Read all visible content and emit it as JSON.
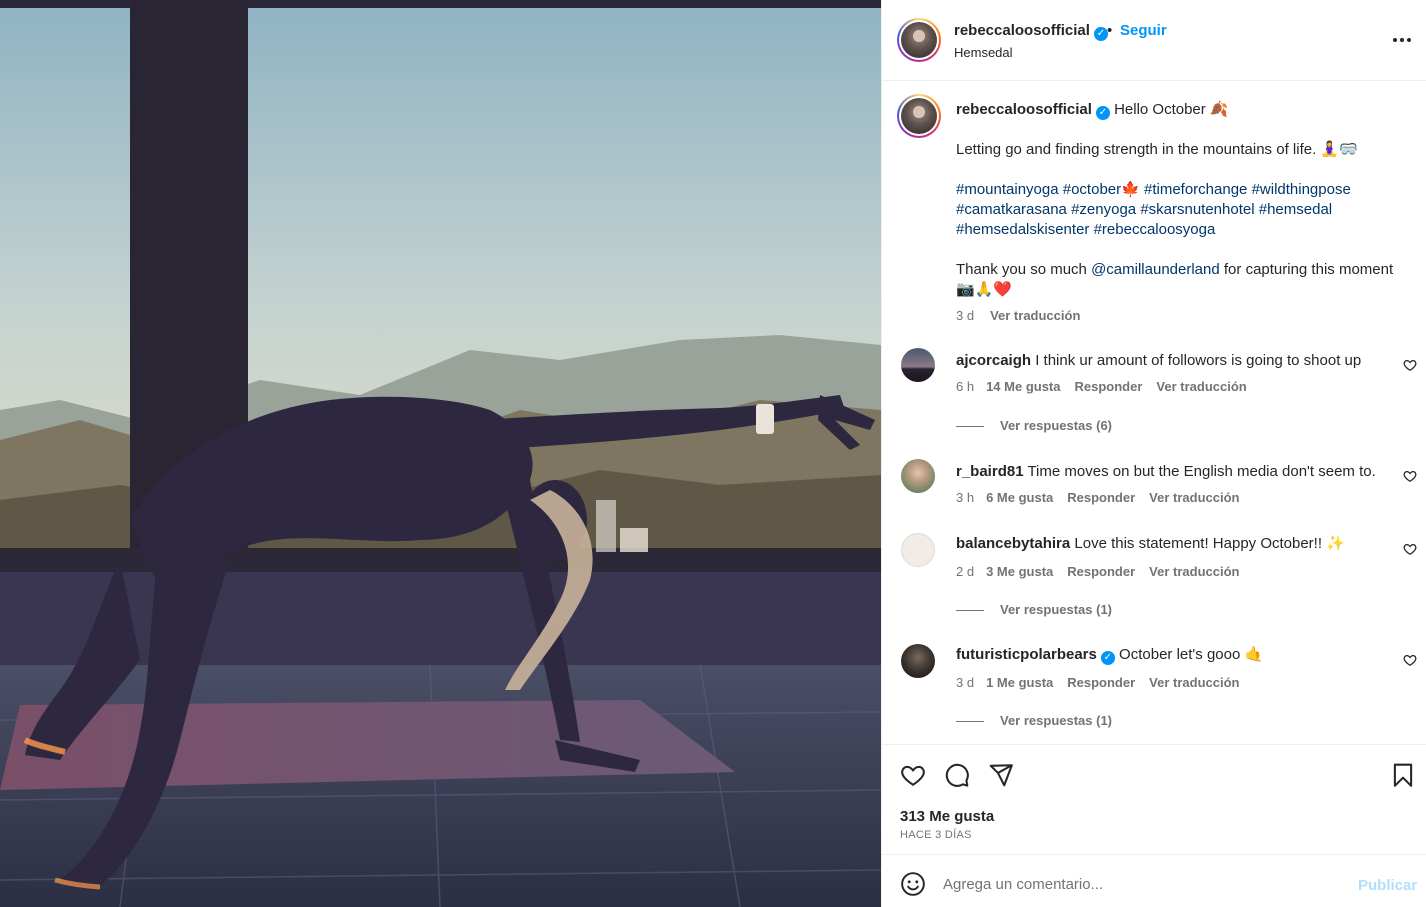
{
  "post": {
    "username": "rebeccaloosofficial",
    "verified_mark": "✓",
    "separator": "•",
    "follow_label": "Seguir",
    "location": "Hemsedal",
    "more_icon": "more-horizontal-icon"
  },
  "caption": {
    "username": "rebeccaloosofficial",
    "line1": "Hello October 🍂",
    "line2": "Letting go and finding strength in the mountains of life. 🧘‍♀️🥽",
    "hashtags": [
      "#mountainyoga",
      "#october🍁",
      "#timeforchange",
      "#wildthingpose",
      "#camatkarasana",
      "#zenyoga",
      "#skarsnutenhotel",
      "#hemsedal",
      "#hemsedalskisenter",
      "#rebeccaloosyoga"
    ],
    "thanks_prefix": "Thank you so much",
    "mention": "@camillaunderland",
    "thanks_suffix": "for capturing this moment 📷🙏❤️",
    "time": "3 d",
    "translate": "Ver traducción"
  },
  "comments": [
    {
      "username": "ajcorcaigh",
      "verified": false,
      "text": "I think ur amount of followors is going to shoot up",
      "time": "6 h",
      "likes": "14 Me gusta",
      "reply": "Responder",
      "translate": "Ver traducción",
      "replies": "Ver respuestas (6)"
    },
    {
      "username": "r_baird81",
      "verified": false,
      "text": "Time moves on but the English media don't seem to.",
      "time": "3 h",
      "likes": "6 Me gusta",
      "reply": "Responder",
      "translate": "Ver traducción",
      "replies": ""
    },
    {
      "username": "balancebytahira",
      "verified": false,
      "text": "Love this statement! Happy October!! ✨",
      "time": "2 d",
      "likes": "3 Me gusta",
      "reply": "Responder",
      "translate": "Ver traducción",
      "replies": "Ver respuestas (1)"
    },
    {
      "username": "futuristicpolarbears",
      "verified": true,
      "text": "October let's gooo 🤙",
      "time": "3 d",
      "likes": "1 Me gusta",
      "reply": "Responder",
      "translate": "Ver traducción",
      "replies": "Ver respuestas (1)"
    }
  ],
  "actions": {
    "like_icon": "heart-icon",
    "comment_icon": "comment-icon",
    "share_icon": "send-icon",
    "save_icon": "bookmark-icon",
    "likes_count": "313 Me gusta",
    "date": "HACE 3 DÍAS"
  },
  "composer": {
    "emoji_icon": "smiley-icon",
    "placeholder": "Agrega un comentario...",
    "post_label": "Publicar"
  },
  "colors": {
    "link_blue": "#0095f6",
    "hashtag_blue": "#00376b",
    "muted": "#737373",
    "text": "#262626",
    "post_disabled": "#b2dffc"
  }
}
